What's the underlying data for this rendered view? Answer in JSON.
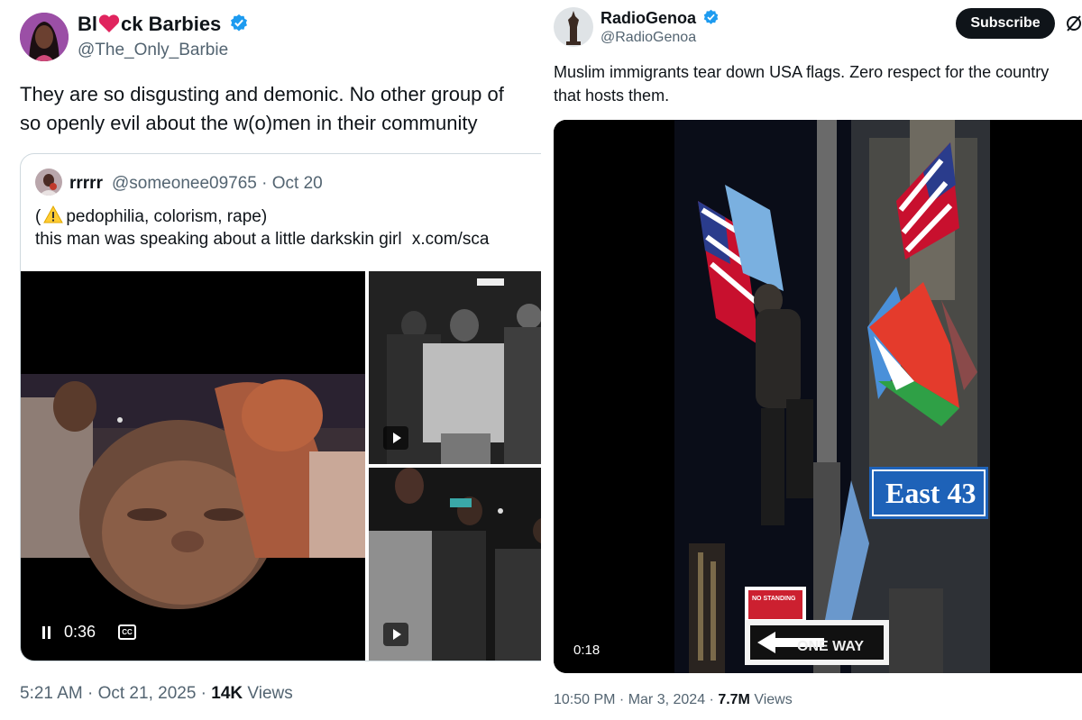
{
  "left_post": {
    "display_name_part1": "Bl",
    "display_name_part2": "ck Barbies",
    "name_heart": "heart-emoji",
    "handle": "@The_Only_Barbie",
    "text_line1": "They are so disgusting and demonic. No other group of",
    "text_line2": "so openly evil about the w(o)men in their community",
    "quoted": {
      "name": "rrrrr",
      "handle": "@someonee09765",
      "separator": "·",
      "date": "Oct 20",
      "line1_open": "(",
      "line1_rest": "pedophilia, colorism, rape)",
      "line2": "this man was speaking about a little darkskin girl",
      "link": "x.com/sca",
      "warning_icon": "warning-icon",
      "video_time": "0:36",
      "cc_label": "CC"
    },
    "timestamp": "5:21 AM · Oct 21, 2025 · ",
    "views_count": "14K",
    "views_label": " Views"
  },
  "right_post": {
    "display_name": "RadioGenoa",
    "handle": "@RadioGenoa",
    "subscribe_label": "Subscribe",
    "text_line1": "Muslim immigrants tear down USA flags. Zero respect for the country",
    "text_line2": "that hosts them.",
    "video_time": "0:18",
    "street_sign": "East 43",
    "no_standing_sign": "NO STANDING",
    "one_way_sign": "ONE WAY",
    "timestamp": "10:50 PM · Mar 3, 2024 · ",
    "views_count": "7.7M",
    "views_label": " Views"
  },
  "colors": {
    "verified_blue": "#1d9bf0",
    "text": "#0f1419",
    "secondary": "#536471",
    "border": "#cfd9de"
  }
}
